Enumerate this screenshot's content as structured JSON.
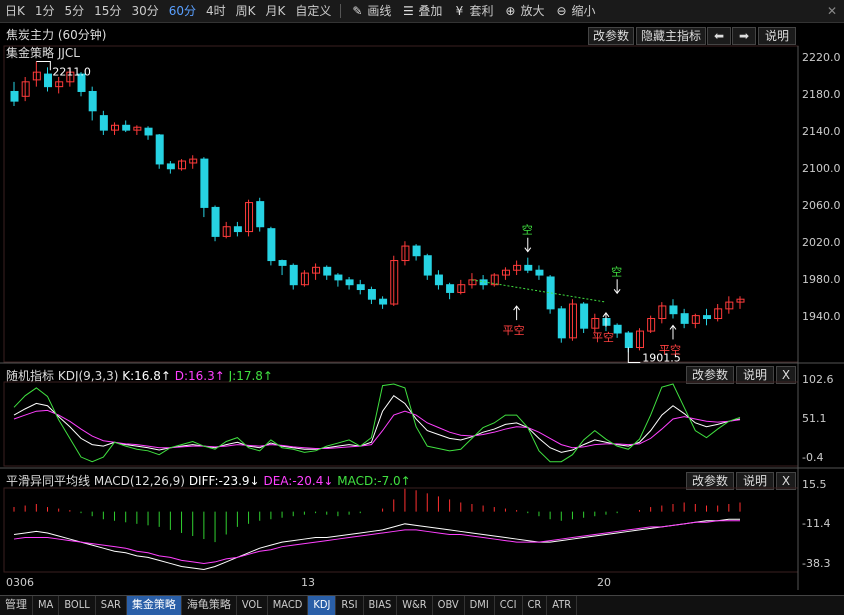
{
  "toolbar": {
    "periods": [
      "日K",
      "1分",
      "5分",
      "15分",
      "30分",
      "60分",
      "4时",
      "周K",
      "月K",
      "自定义"
    ],
    "active_period": "60分",
    "tools": [
      {
        "icon": "pencil-icon",
        "glyph": "✎",
        "label": "画线"
      },
      {
        "icon": "stack-icon",
        "glyph": "☰",
        "label": "叠加"
      },
      {
        "icon": "money-bag-icon",
        "glyph": "¥",
        "label": "套利"
      },
      {
        "icon": "zoom-in-icon",
        "glyph": "⊕",
        "label": "放大"
      },
      {
        "icon": "zoom-out-icon",
        "glyph": "⊖",
        "label": "缩小"
      }
    ],
    "close_glyph": "✕"
  },
  "main": {
    "title": "焦炭主力 (60分钟)",
    "indicator_title": "集金策略 JJCL",
    "buttons": {
      "params": "改参数",
      "hide": "隐藏主指标",
      "left": "⬅",
      "right": "➡",
      "help": "说明"
    },
    "yaxis": [
      "2220.0",
      "2180.0",
      "2140.0",
      "2100.0",
      "2060.0",
      "2020.0",
      "1980.0",
      "1940.0"
    ],
    "high_label": "2211.0",
    "low_label": "1901.5",
    "signals": [
      "空",
      "平空",
      "空",
      "平空",
      "平空"
    ]
  },
  "kdj": {
    "name": "随机指标",
    "params": "KDJ(9,3,3)",
    "k": "K:16.8↑",
    "d": "D:16.3↑",
    "j": "J:17.8↑",
    "yaxis": [
      "102.6",
      "51.1",
      "-0.4"
    ],
    "buttons": {
      "params": "改参数",
      "help": "说明",
      "close": "X"
    }
  },
  "macd": {
    "name": "平滑异同平均线",
    "params": "MACD(12,26,9)",
    "diff": "DIFF:-23.9↓",
    "dea": "DEA:-20.4↓",
    "macd": "MACD:-7.0↑",
    "yaxis": [
      "15.5",
      "-11.4",
      "-38.3"
    ],
    "buttons": {
      "params": "改参数",
      "help": "说明",
      "close": "X"
    }
  },
  "xaxis": [
    "0306",
    "13",
    "20"
  ],
  "bottom_tabs": [
    "管理",
    "MA",
    "BOLL",
    "SAR",
    "集金策略",
    "海龟策略",
    "VOL",
    "MACD",
    "KDJ",
    "RSI",
    "BIAS",
    "W&R",
    "OBV",
    "DMI",
    "CCI",
    "CR",
    "ATR"
  ],
  "selected_tabs": [
    "集金策略",
    "KDJ"
  ],
  "colors": {
    "up": "#ff3b3b",
    "down": "#27d3e3",
    "k": "#ffffff",
    "d": "#ff40ff",
    "j": "#40e040",
    "macd_pos": "#ff3030",
    "macd_neg": "#30d030",
    "dashed": "#40e040",
    "signal_sell": "#40e040",
    "signal_cover": "#ff4040"
  },
  "chart_data": [
    {
      "type": "candlestick",
      "title": "焦炭主力 (60分钟)",
      "ylim": [
        1900,
        2225
      ],
      "candles": [
        [
          2180,
          2190,
          2165,
          2170
        ],
        [
          2175,
          2195,
          2170,
          2190
        ],
        [
          2192,
          2211,
          2185,
          2200
        ],
        [
          2198,
          2205,
          2180,
          2185
        ],
        [
          2185,
          2195,
          2178,
          2190
        ],
        [
          2190,
          2205,
          2185,
          2200
        ],
        [
          2198,
          2200,
          2175,
          2180
        ],
        [
          2180,
          2185,
          2150,
          2160
        ],
        [
          2155,
          2160,
          2135,
          2140
        ],
        [
          2140,
          2148,
          2135,
          2145
        ],
        [
          2145,
          2150,
          2138,
          2140
        ],
        [
          2140,
          2145,
          2135,
          2143
        ],
        [
          2142,
          2144,
          2130,
          2135
        ],
        [
          2135,
          2136,
          2100,
          2105
        ],
        [
          2105,
          2108,
          2095,
          2100
        ],
        [
          2100,
          2110,
          2098,
          2108
        ],
        [
          2106,
          2114,
          2100,
          2110
        ],
        [
          2110,
          2112,
          2050,
          2060
        ],
        [
          2060,
          2062,
          2025,
          2030
        ],
        [
          2030,
          2045,
          2028,
          2040
        ],
        [
          2040,
          2045,
          2030,
          2035
        ],
        [
          2035,
          2068,
          2030,
          2065
        ],
        [
          2066,
          2070,
          2035,
          2040
        ],
        [
          2038,
          2040,
          2000,
          2005
        ],
        [
          2005,
          2006,
          1990,
          2000
        ],
        [
          2000,
          2002,
          1975,
          1980
        ],
        [
          1980,
          1995,
          1978,
          1992
        ],
        [
          1992,
          2002,
          1985,
          1998
        ],
        [
          1998,
          2000,
          1985,
          1990
        ],
        [
          1990,
          1992,
          1978,
          1985
        ],
        [
          1985,
          1988,
          1975,
          1980
        ],
        [
          1980,
          1985,
          1970,
          1975
        ],
        [
          1975,
          1978,
          1960,
          1965
        ],
        [
          1965,
          1968,
          1955,
          1960
        ],
        [
          1960,
          2010,
          1958,
          2005
        ],
        [
          2005,
          2025,
          2000,
          2020
        ],
        [
          2020,
          2022,
          2005,
          2010
        ],
        [
          2010,
          2012,
          1985,
          1990
        ],
        [
          1990,
          1995,
          1975,
          1980
        ],
        [
          1980,
          1982,
          1965,
          1972
        ],
        [
          1972,
          1985,
          1970,
          1980
        ],
        [
          1980,
          1992,
          1976,
          1985
        ],
        [
          1985,
          1990,
          1975,
          1980
        ],
        [
          1980,
          1992,
          1978,
          1990
        ],
        [
          1990,
          1998,
          1985,
          1995
        ],
        [
          1995,
          2005,
          1990,
          2000
        ],
        [
          2000,
          2008,
          1992,
          1995
        ],
        [
          1995,
          2000,
          1985,
          1990
        ],
        [
          1988,
          1990,
          1950,
          1955
        ],
        [
          1955,
          1958,
          1920,
          1925
        ],
        [
          1925,
          1965,
          1922,
          1960
        ],
        [
          1960,
          1962,
          1930,
          1935
        ],
        [
          1935,
          1950,
          1930,
          1945
        ],
        [
          1945,
          1948,
          1932,
          1938
        ],
        [
          1938,
          1940,
          1925,
          1930
        ],
        [
          1930,
          1932,
          1910,
          1915
        ],
        [
          1915,
          1935,
          1912,
          1932
        ],
        [
          1932,
          1948,
          1930,
          1945
        ],
        [
          1945,
          1962,
          1940,
          1958
        ],
        [
          1958,
          1965,
          1945,
          1950
        ],
        [
          1950,
          1955,
          1935,
          1940
        ],
        [
          1940,
          1950,
          1935,
          1948
        ],
        [
          1948,
          1955,
          1938,
          1945
        ],
        [
          1945,
          1960,
          1942,
          1955
        ],
        [
          1955,
          1968,
          1950,
          1962
        ],
        [
          1962,
          1968,
          1955,
          1965
        ]
      ],
      "high": 2211.0,
      "low": 1901.5
    },
    {
      "type": "line",
      "title": "随机指标 KDJ(9,3,3)",
      "ylim": [
        -0.4,
        102.6
      ],
      "series": [
        {
          "name": "K",
          "values": [
            60,
            68,
            75,
            72,
            58,
            45,
            30,
            22,
            20,
            25,
            22,
            20,
            18,
            15,
            18,
            20,
            22,
            20,
            18,
            22,
            25,
            20,
            18,
            24,
            20,
            18,
            16,
            16,
            18,
            20,
            22,
            20,
            25,
            65,
            85,
            75,
            55,
            40,
            35,
            30,
            28,
            32,
            38,
            42,
            48,
            50,
            44,
            30,
            18,
            12,
            15,
            22,
            28,
            25,
            22,
            20,
            25,
            40,
            60,
            72,
            62,
            50,
            45,
            48,
            52,
            55
          ]
        },
        {
          "name": "D",
          "values": [
            55,
            60,
            65,
            66,
            60,
            52,
            42,
            33,
            27,
            25,
            23,
            22,
            20,
            18,
            18,
            19,
            20,
            20,
            19,
            20,
            22,
            21,
            20,
            22,
            21,
            19,
            18,
            17,
            17,
            18,
            19,
            20,
            22,
            40,
            60,
            65,
            60,
            50,
            44,
            38,
            34,
            33,
            35,
            38,
            42,
            45,
            44,
            38,
            30,
            22,
            18,
            19,
            22,
            23,
            23,
            22,
            23,
            30,
            42,
            55,
            58,
            55,
            52,
            51,
            52,
            54
          ]
        },
        {
          "name": "J",
          "values": [
            70,
            85,
            95,
            84,
            54,
            30,
            6,
            0,
            6,
            25,
            20,
            16,
            14,
            9,
            18,
            22,
            26,
            20,
            16,
            26,
            31,
            18,
            14,
            28,
            18,
            16,
            12,
            14,
            20,
            24,
            28,
            20,
            31,
            98,
            100,
            95,
            45,
            20,
            17,
            14,
            16,
            30,
            44,
            50,
            60,
            60,
            44,
            14,
            0,
            0,
            9,
            28,
            40,
            29,
            20,
            16,
            29,
            60,
            96,
            100,
            70,
            40,
            31,
            42,
            52,
            57
          ]
        }
      ]
    },
    {
      "type": "bar",
      "title": "平滑异同平均线 MACD(12,26,9)",
      "ylim": [
        -38.3,
        15.5
      ],
      "series": [
        {
          "name": "MACD",
          "values": [
            3,
            4,
            5,
            3,
            2,
            1,
            -1,
            -3,
            -5,
            -6,
            -7,
            -8,
            -9,
            -10,
            -12,
            -14,
            -16,
            -18,
            -20,
            -15,
            -10,
            -8,
            -6,
            -5,
            -4,
            -3,
            -2,
            -1,
            -2,
            -3,
            -2,
            -1,
            0,
            2,
            8,
            15,
            14,
            12,
            10,
            8,
            6,
            5,
            4,
            3,
            2,
            1,
            -1,
            -3,
            -5,
            -6,
            -5,
            -4,
            -3,
            -2,
            -1,
            0,
            1,
            3,
            4,
            5,
            6,
            5,
            4,
            4,
            5,
            6
          ]
        },
        {
          "name": "DIFF",
          "values": [
            -15,
            -14,
            -13,
            -14,
            -16,
            -18,
            -20,
            -22,
            -24,
            -26,
            -27,
            -29,
            -30,
            -32,
            -34,
            -36,
            -37,
            -38,
            -36,
            -33,
            -30,
            -27,
            -24,
            -22,
            -20,
            -19,
            -18,
            -17,
            -17,
            -16,
            -15,
            -14,
            -13,
            -12,
            -10,
            -8,
            -9,
            -10,
            -11,
            -12,
            -13,
            -14,
            -15,
            -16,
            -17,
            -18,
            -19,
            -20,
            -20,
            -19,
            -18,
            -17,
            -16,
            -15,
            -14,
            -13,
            -12,
            -11,
            -10,
            -9,
            -8,
            -7,
            -6,
            -6,
            -5,
            -5
          ]
        },
        {
          "name": "DEA",
          "values": [
            -18,
            -17,
            -17,
            -17,
            -18,
            -19,
            -20,
            -21,
            -22,
            -23,
            -24,
            -26,
            -27,
            -29,
            -30,
            -32,
            -33,
            -34,
            -33,
            -31,
            -30,
            -28,
            -26,
            -25,
            -23,
            -22,
            -21,
            -20,
            -19,
            -18,
            -17,
            -16,
            -15,
            -14,
            -13,
            -12,
            -12,
            -13,
            -14,
            -15,
            -15,
            -16,
            -17,
            -18,
            -19,
            -20,
            -20,
            -20,
            -19,
            -18,
            -17,
            -16,
            -15,
            -14,
            -13,
            -12,
            -11,
            -10,
            -10,
            -9,
            -8,
            -7,
            -7,
            -6,
            -6,
            -6
          ]
        }
      ]
    }
  ]
}
